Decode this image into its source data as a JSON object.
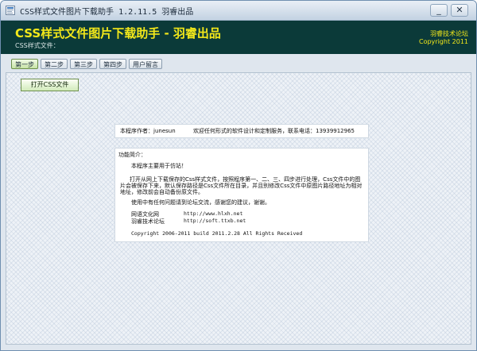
{
  "window": {
    "title": "CSS样式文件图片下载助手  1.2.11.5  羽睿出品",
    "minimize_glyph": "_",
    "close_glyph": "✕"
  },
  "banner": {
    "title": "CSS样式文件图片下载助手 - 羽睿出品",
    "subtitle": "CSS样式文件：",
    "right_line1": "羽睿技术论坛",
    "right_line2": "Copyright 2011"
  },
  "tabs": [
    {
      "label": "第一步",
      "active": true
    },
    {
      "label": "第二步",
      "active": false
    },
    {
      "label": "第三步",
      "active": false
    },
    {
      "label": "第四步",
      "active": false
    },
    {
      "label": "用户留言",
      "active": false
    }
  ],
  "open_button": "打开CSS文件",
  "author": {
    "name": "本程序作者：junesun",
    "message": "欢迎任何形式的软件设计和定制服务，联系电话：13939912965"
  },
  "info": {
    "label": "功能简介：",
    "line1": "本程序主要用于仿站！",
    "para": "打开从网上下载保存的Css样式文件，按照程序第一、二、三、四步进行处理，Css文件中的图片会被保存下来，默认保存路径是Css文件所在目录，并且别修改Css文件中原图片路径地址为相对地址，修改前会自动备份原文件。",
    "line3": "使用中有任何问题请到论坛交流，感谢您的建议，谢谢。",
    "links": [
      {
        "label": "网语文化网",
        "url": "http://www.hlxh.net"
      },
      {
        "label": "羽睿技术论坛",
        "url": "http://soft.ttxb.net"
      }
    ],
    "copyright": "Copyright 2006-2011  build 2011.2.28  All Rights Received"
  },
  "colors": {
    "banner_bg": "#0b3a39",
    "banner_text": "#f3e81a",
    "active_tab": "#c7e3a6"
  }
}
